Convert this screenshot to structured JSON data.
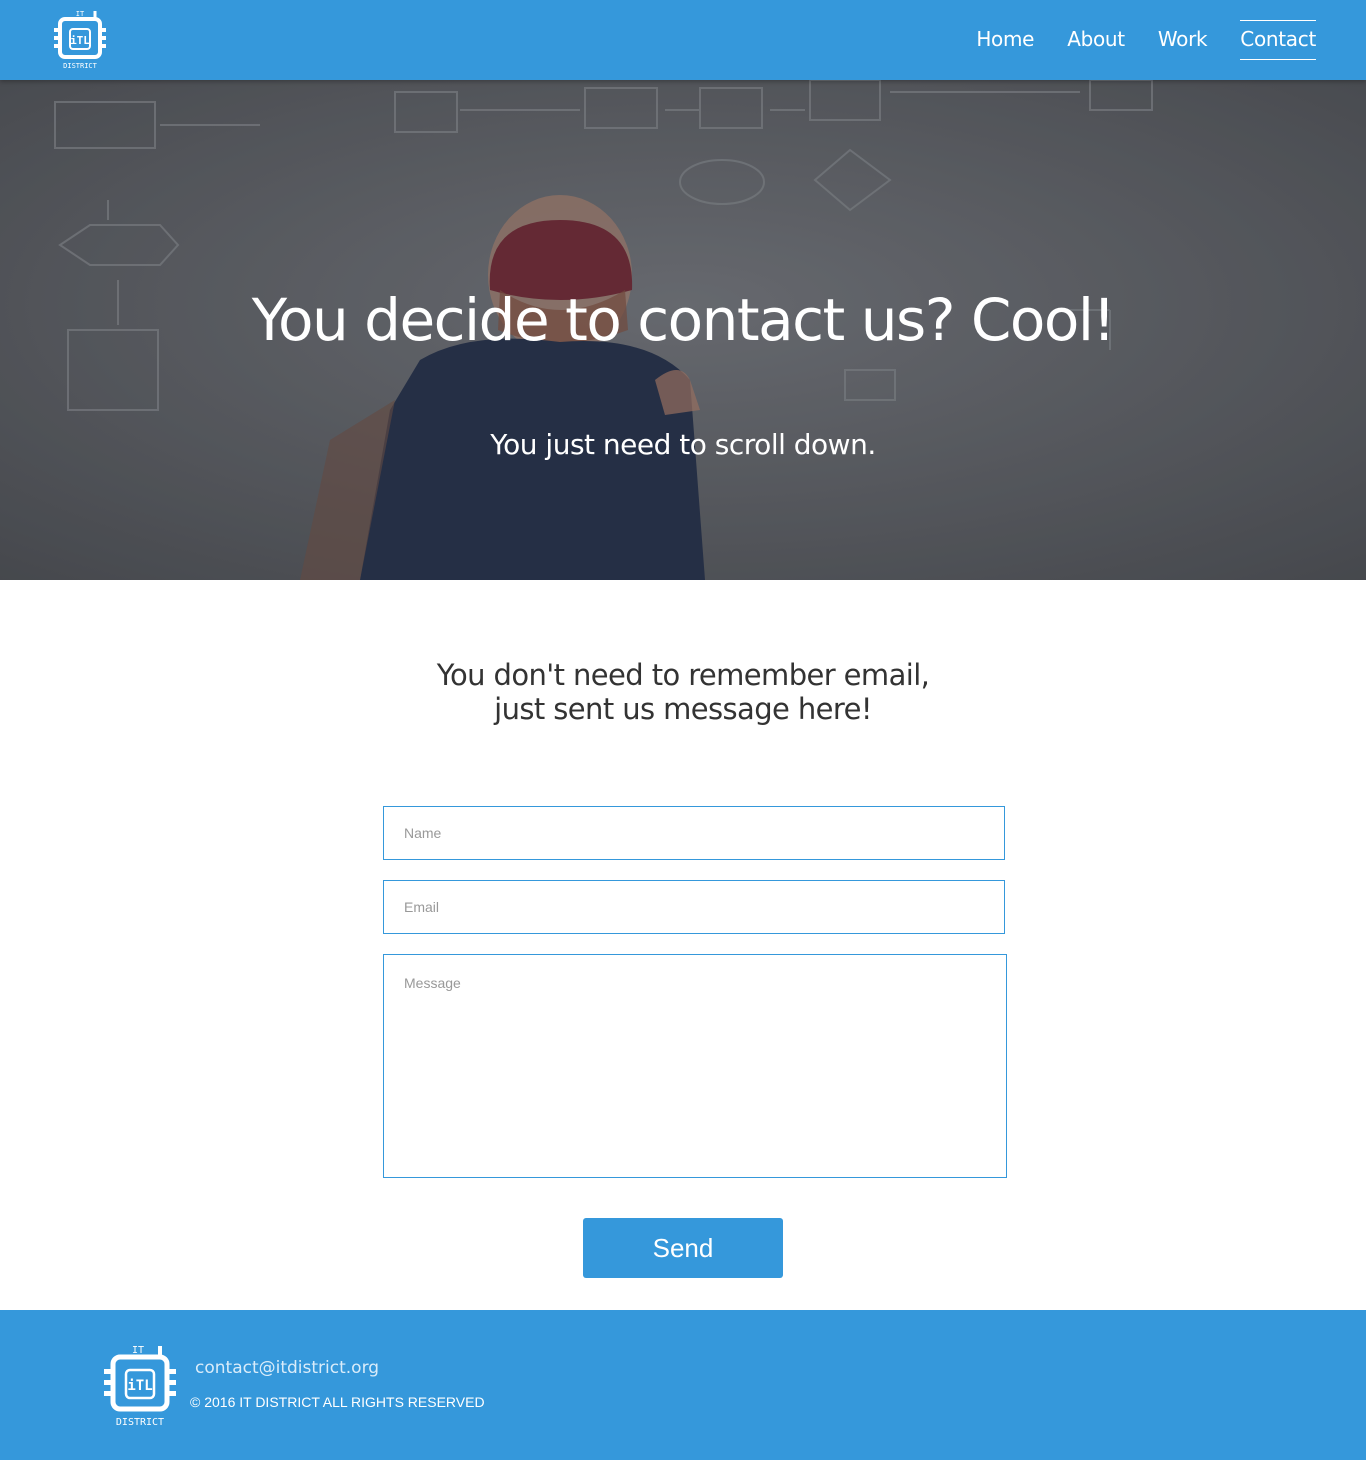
{
  "brand": {
    "logo_top": "IT",
    "logo_mid": "iTL",
    "logo_bottom": "DISTRICT",
    "primary_color": "#3598db"
  },
  "nav": {
    "items": [
      {
        "label": "Home"
      },
      {
        "label": "About"
      },
      {
        "label": "Work"
      },
      {
        "label": "Contact",
        "active": true
      }
    ]
  },
  "hero": {
    "title": "You decide to contact us? Cool!",
    "subtitle": "You just need to scroll down.",
    "image": "man-at-whiteboard-flowchart"
  },
  "contact": {
    "intro_line1": "You don't need to remember email,",
    "intro_line2": "just sent us message here!",
    "name_placeholder": "Name",
    "email_placeholder": "Email",
    "message_placeholder": "Message",
    "send_label": "Send"
  },
  "footer": {
    "email": "contact@itdistrict.org",
    "copyright": "© 2016 IT DISTRICT ALL RIGHTS RESERVED"
  }
}
